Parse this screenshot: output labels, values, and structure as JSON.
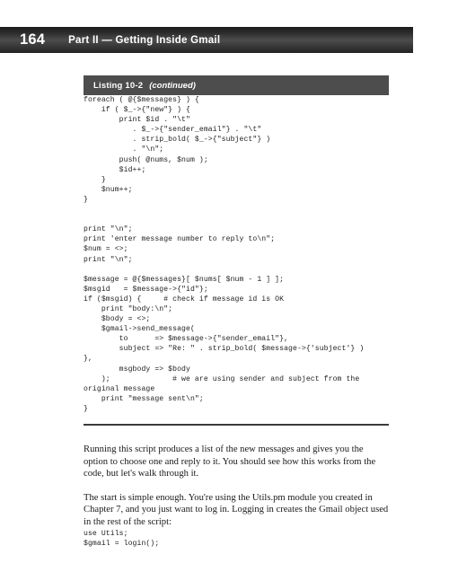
{
  "page": {
    "folio": "164",
    "running_head": "Part II  —  Getting Inside Gmail",
    "header_bg": "#3a3a3a"
  },
  "listing": {
    "label": "Listing 10-2",
    "note": "(continued)",
    "bar_bg": "#4d4d4d",
    "code": "foreach ( @{$messages} ) {\n    if ( $_->{\"new\"} ) {\n        print $id . \"\\t\"\n           . $_->{\"sender_email\"} . \"\\t\"\n           . strip_bold( $_->{\"subject\"} )\n           . \"\\n\";\n        push( @nums, $num );\n        $id++;\n    }\n    $num++;\n}\n\n\nprint \"\\n\";\nprint 'enter message number to reply to\\n\";\n$num = <>;\nprint \"\\n\";\n\n$message = @{$messages}[ $nums[ $num - 1 ] ];\n$msgid   = $message->{\"id\"};\nif ($msgid) {     # check if message id is OK\n    print \"body:\\n\";\n    $body = <>;\n    $gmail->send_message(\n        to      => $message->{\"sender_email\"},\n        subject => \"Re: \" . strip_bold( $message->{'subject'} )\n},\n        msgbody => $body\n    );              # we are using sender and subject from the\noriginal message\n    print \"message sent\\n\";\n}"
  },
  "body": {
    "paragraph_1": "Running this script produces a list of the new messages and gives you the option to choose one and reply to it. You should see how this works from the code, but let's walk through it.",
    "paragraph_2": "The start is simple enough. You're using the Utils.pm module you created in Chapter 7, and you just want to log in. Logging in creates the Gmail object used in the rest of the script:",
    "code_use": "use Utils;",
    "code_login": "$gmail = login();"
  }
}
